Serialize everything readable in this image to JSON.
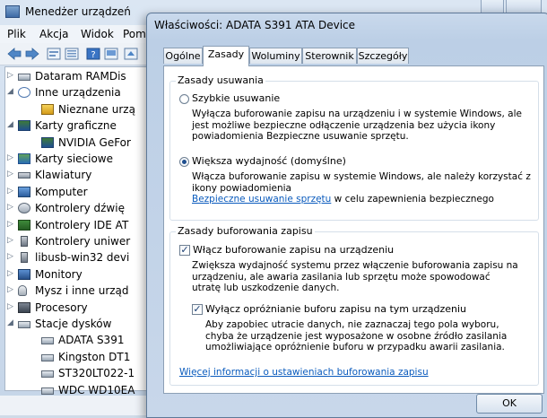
{
  "device_manager": {
    "title": "Menedżer urządzeń",
    "menu": [
      "Plik",
      "Akcja",
      "Widok",
      "Pom"
    ],
    "tree": [
      {
        "label": "Dataram RAMDis",
        "arrow": "▷",
        "level": 1,
        "icon": "drive-icon"
      },
      {
        "label": "Inne urządzenia",
        "arrow": "◢",
        "level": 1,
        "icon": "unknown-device-icon"
      },
      {
        "label": "Nieznane urzą",
        "arrow": "",
        "level": 2,
        "icon": "warning-device-icon"
      },
      {
        "label": "Karty graficzne",
        "arrow": "◢",
        "level": 1,
        "icon": "display-adapter-icon"
      },
      {
        "label": "NVIDIA GeFor",
        "arrow": "",
        "level": 2,
        "icon": "display-adapter-icon"
      },
      {
        "label": "Karty sieciowe",
        "arrow": "▷",
        "level": 1,
        "icon": "network-icon"
      },
      {
        "label": "Klawiatury",
        "arrow": "▷",
        "level": 1,
        "icon": "keyboard-icon"
      },
      {
        "label": "Komputer",
        "arrow": "▷",
        "level": 1,
        "icon": "computer-icon"
      },
      {
        "label": "Kontrolery dźwię",
        "arrow": "▷",
        "level": 1,
        "icon": "sound-icon"
      },
      {
        "label": "Kontrolery IDE AT",
        "arrow": "▷",
        "level": 1,
        "icon": "ide-controller-icon"
      },
      {
        "label": "Kontrolery uniwer",
        "arrow": "▷",
        "level": 1,
        "icon": "usb-icon"
      },
      {
        "label": "libusb-win32 devi",
        "arrow": "▷",
        "level": 1,
        "icon": "usb-icon"
      },
      {
        "label": "Monitory",
        "arrow": "▷",
        "level": 1,
        "icon": "monitor-icon"
      },
      {
        "label": "Mysz i inne urząd",
        "arrow": "▷",
        "level": 1,
        "icon": "mouse-icon"
      },
      {
        "label": "Procesory",
        "arrow": "▷",
        "level": 1,
        "icon": "processor-icon"
      },
      {
        "label": "Stacje dysków",
        "arrow": "◢",
        "level": 1,
        "icon": "drive-icon"
      },
      {
        "label": "ADATA S391",
        "arrow": "",
        "level": 2,
        "icon": "drive-icon"
      },
      {
        "label": "Kingston DT1",
        "arrow": "",
        "level": 2,
        "icon": "drive-icon"
      },
      {
        "label": "ST320LT022-1",
        "arrow": "",
        "level": 2,
        "icon": "drive-icon"
      },
      {
        "label": "WDC WD10EA",
        "arrow": "",
        "level": 2,
        "icon": "drive-icon"
      }
    ]
  },
  "dialog": {
    "title": "Właściwości: ADATA S391 ATA Device",
    "tabs": [
      "Ogólne",
      "Zasady",
      "Woluminy",
      "Sterownik",
      "Szczegóły"
    ],
    "active_tab": "Zasady",
    "removal_group": {
      "title": "Zasady usuwania",
      "quick": {
        "label": "Szybkie usuwanie",
        "selected": false,
        "desc": "Wyłącza buforowanie zapisu na urządzeniu i w systemie Windows, ale jest możliwe bezpieczne odłączenie urządzenia bez użycia ikony powiadomienia Bezpieczne usuwanie sprzętu."
      },
      "performance": {
        "label": "Większa wydajność (domyślne)",
        "selected": true,
        "desc": "Włącza buforowanie zapisu w systemie Windows, ale należy korzystać z ikony powiadomienia",
        "link": "Bezpieczne usuwanie sprzętu",
        "desc_after_link": "w celu zapewnienia bezpiecznego"
      }
    },
    "cache_group": {
      "title": "Zasady buforowania zapisu",
      "enable_cache": {
        "label": "Włącz buforowanie zapisu na urządzeniu",
        "checked": true,
        "desc": "Zwiększa wydajność systemu przez włączenie buforowania zapisu na urządzeniu, ale awaria zasilania lub sprzętu może spowodować utratę lub uszkodzenie danych."
      },
      "disable_flush": {
        "label": "Wyłącz opróżnianie buforu zapisu na tym urządzeniu",
        "checked": true,
        "desc": "Aby zapobiec utracie danych, nie zaznaczaj tego pola wyboru, chyba że urządzenie jest wyposażone w osobne źródło zasilania umożliwiające opróżnienie buforu w przypadku awarii zasilania."
      },
      "more_info_link": "Więcej informacji o ustawieniach buforowania zapisu"
    },
    "ok_label": "OK"
  }
}
